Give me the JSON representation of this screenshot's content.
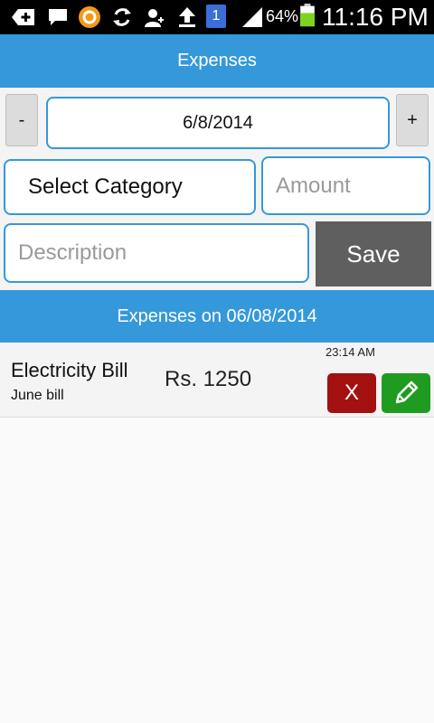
{
  "status_bar": {
    "battery_percent": "64%",
    "time": "11:16 PM",
    "notification_badge": "1",
    "icons": [
      "back-plus-icon",
      "chat-icon",
      "orange-app-icon",
      "sync-icon",
      "person-add-icon",
      "upload-icon",
      "document-badge-icon",
      "signal-icon",
      "battery-icon"
    ]
  },
  "app": {
    "title": "Expenses"
  },
  "form": {
    "decrement_label": "-",
    "date_value": "6/8/2014",
    "increment_label": "+",
    "category_label": "Select Category",
    "amount_placeholder": "Amount",
    "description_placeholder": "Description",
    "save_label": "Save"
  },
  "list": {
    "header": "Expenses on 06/08/2014",
    "items": [
      {
        "title": "Electricity Bill",
        "note": "June bill",
        "amount": "Rs. 1250",
        "time": "23:14 AM",
        "delete_label": "X"
      }
    ]
  },
  "colors": {
    "accent": "#3598db",
    "save_button": "#5f5f5f",
    "delete_button": "#a31010",
    "edit_button": "#1f9b1f"
  }
}
